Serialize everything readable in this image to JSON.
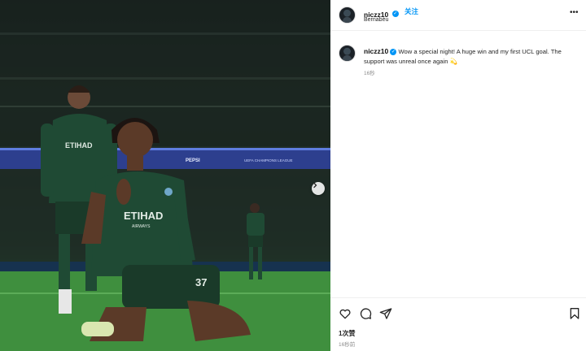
{
  "post": {
    "username": "niczz10",
    "follow_label": "关注",
    "location": "Bernabéu",
    "more_options_label": "•••",
    "caption_username": "niczz10",
    "caption_text": "Wow a special night! A huge win and my first UCL goal. The support was unreal once again 💫",
    "caption_time": "16秒",
    "likes": "1次赞",
    "post_time": "16秒前"
  },
  "photo": {
    "jersey_sponsor": "ETIHAD",
    "jersey_sponsor_sub": "AIRWAYS",
    "jersey_number": "37",
    "led_board_text": "UEFA CHAMPIONS LEAGUE",
    "led_board_left": "PEPSI"
  },
  "icons": {
    "next": "chevron-right-icon",
    "like": "heart-icon",
    "comment": "comment-icon",
    "share": "paper-plane-icon",
    "save": "bookmark-icon"
  },
  "colors": {
    "link_blue": "#0095f6",
    "jersey_green": "#1f4a34",
    "pitch_green": "#3f8f3e"
  }
}
